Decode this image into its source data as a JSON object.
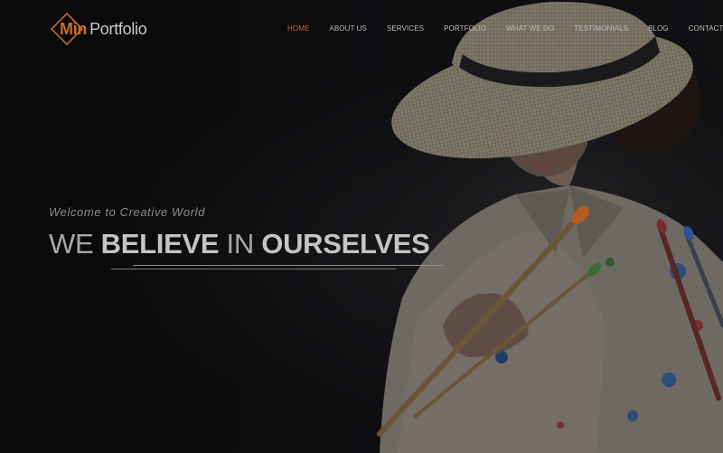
{
  "brand": {
    "strong": "Min",
    "light": "Portfolio",
    "accent_color": "#c96a28"
  },
  "nav": {
    "items": [
      {
        "label": "HOME",
        "active": true
      },
      {
        "label": "ABOUT US"
      },
      {
        "label": "SERVICES"
      },
      {
        "label": "PORTFOLIO"
      },
      {
        "label": "WHAT WE DO"
      },
      {
        "label": "TESTIMONIALS"
      },
      {
        "label": "BLOG"
      },
      {
        "label": "CONTACT US"
      }
    ]
  },
  "hero": {
    "subtitle": "Welcome to Creative World",
    "headline": {
      "part1": "WE",
      "part2": "BELIEVE",
      "part3": "IN",
      "part4": "OURSELVES"
    },
    "image_icon": "painter-with-hat-illustration"
  }
}
